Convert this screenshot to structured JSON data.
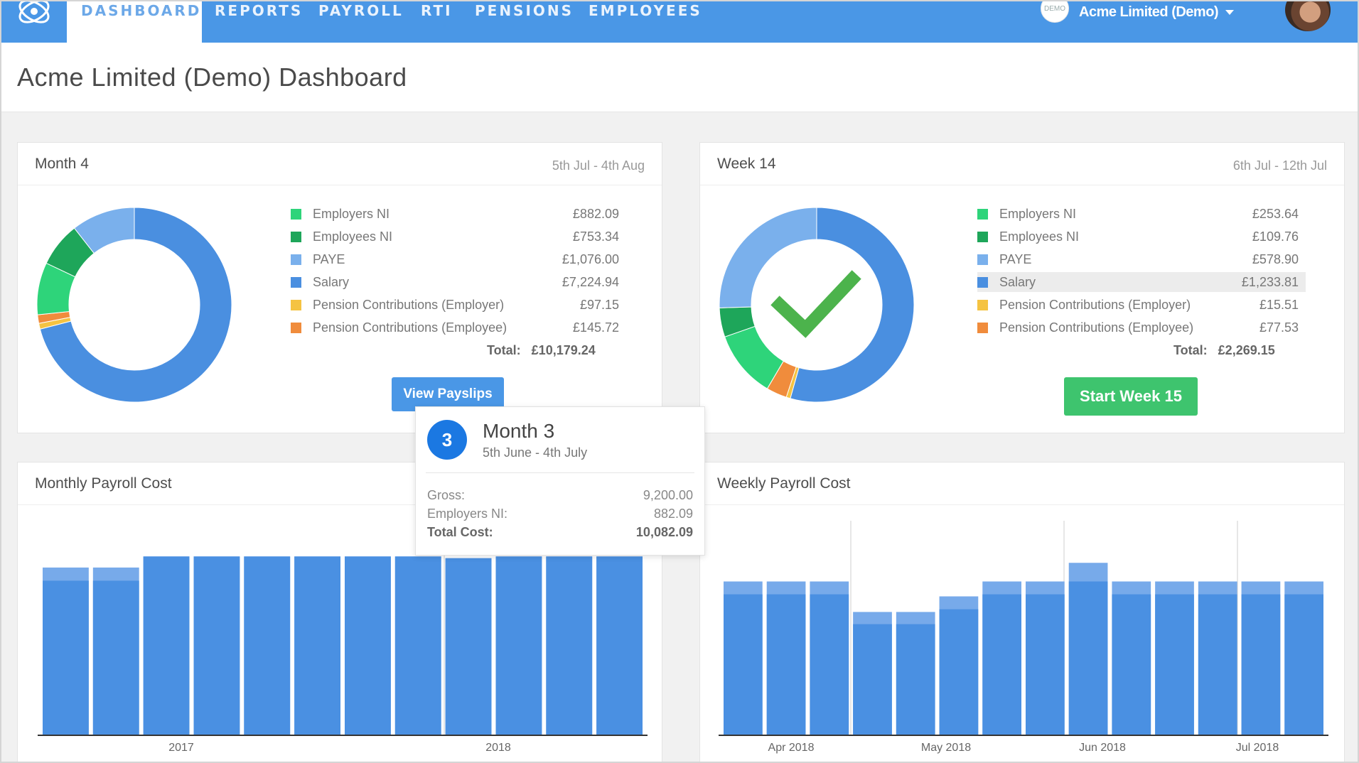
{
  "nav": {
    "items": [
      "DASHBOARD",
      "REPORTS",
      "PAYROLL",
      "RTI",
      "PENSIONS",
      "EMPLOYEES"
    ],
    "active": "DASHBOARD",
    "company_badge": "DEMO",
    "company_name": "Acme Limited (Demo)"
  },
  "page": {
    "title": "Acme Limited (Demo) Dashboard"
  },
  "colors": {
    "employers_ni": "#2ed47a",
    "employees_ni": "#1ea65a",
    "paye": "#7ab0ec",
    "salary": "#4a8fe0",
    "pension_employer": "#f5c342",
    "pension_employee": "#f08c3c",
    "nav_blue": "#4a97e6",
    "bar_blue": "#4a90e2",
    "bar_top": "#77aaea",
    "check_green": "#4cb34c"
  },
  "month_card": {
    "title": "Month 4",
    "date_range": "5th Jul - 4th Aug",
    "legend": [
      {
        "label": "Employers NI",
        "value": "£882.09",
        "amount": 882.09,
        "color_key": "employers_ni"
      },
      {
        "label": "Employees NI",
        "value": "£753.34",
        "amount": 753.34,
        "color_key": "employees_ni"
      },
      {
        "label": "PAYE",
        "value": "£1,076.00",
        "amount": 1076.0,
        "color_key": "paye"
      },
      {
        "label": "Salary",
        "value": "£7,224.94",
        "amount": 7224.94,
        "color_key": "salary"
      },
      {
        "label": "Pension Contributions (Employer)",
        "value": "£97.15",
        "amount": 97.15,
        "color_key": "pension_employer"
      },
      {
        "label": "Pension Contributions (Employee)",
        "value": "£145.72",
        "amount": 145.72,
        "color_key": "pension_employee"
      }
    ],
    "total_label": "Total:",
    "total_value": "£10,179.24",
    "button_label": "View Payslips"
  },
  "week_card": {
    "title": "Week 14",
    "date_range": "6th Jul - 12th Jul",
    "legend": [
      {
        "label": "Employers NI",
        "value": "£253.64",
        "amount": 253.64,
        "color_key": "employers_ni"
      },
      {
        "label": "Employees NI",
        "value": "£109.76",
        "amount": 109.76,
        "color_key": "employees_ni"
      },
      {
        "label": "PAYE",
        "value": "£578.90",
        "amount": 578.9,
        "color_key": "paye"
      },
      {
        "label": "Salary",
        "value": "£1,233.81",
        "amount": 1233.81,
        "color_key": "salary",
        "highlighted": true
      },
      {
        "label": "Pension Contributions (Employer)",
        "value": "£15.51",
        "amount": 15.51,
        "color_key": "pension_employer"
      },
      {
        "label": "Pension Contributions (Employee)",
        "value": "£77.53",
        "amount": 77.53,
        "color_key": "pension_employee"
      }
    ],
    "total_label": "Total:",
    "total_value": "£2,269.15",
    "button_label": "Start Week 15",
    "complete": true
  },
  "monthly_chart": {
    "title": "Monthly Payroll Cost",
    "x_labels": [
      "2017",
      "2018"
    ]
  },
  "weekly_chart": {
    "title": "Weekly Payroll Cost",
    "x_labels": [
      "Apr 2018",
      "May 2018",
      "Jun 2018",
      "Jul 2018"
    ]
  },
  "chart_data": [
    {
      "type": "bar",
      "title": "Monthly Payroll Cost",
      "ylim": [
        0,
        11000
      ],
      "series": [
        {
          "name": "",
          "values": [
            8800,
            8800,
            10180,
            10180,
            10180,
            10180,
            10180,
            10180,
            10082,
            10180,
            10180,
            10180
          ]
        },
        {
          "name": "",
          "values": [
            9550,
            9550,
            10180,
            10180,
            10180,
            10180,
            10180,
            10180,
            10082,
            10180,
            10180,
            10180
          ]
        }
      ],
      "categories": [
        "1",
        "2",
        "3",
        "4",
        "5",
        "6",
        "7",
        "8",
        "9",
        "10",
        "11",
        "12"
      ],
      "x_tick_labels": [
        "2017",
        "2018"
      ]
    },
    {
      "type": "bar",
      "title": "Weekly Payroll Cost",
      "ylim": [
        0,
        2600
      ],
      "series": [
        {
          "name": "",
          "values": [
            2080,
            2080,
            2080,
            1640,
            1640,
            1860,
            2080,
            2080,
            2270,
            2080,
            2080,
            2080,
            2080,
            2080
          ]
        },
        {
          "name": "",
          "values": [
            2270,
            2270,
            2270,
            1820,
            1820,
            2050,
            2270,
            2270,
            2545,
            2270,
            2270,
            2270,
            2270,
            2270
          ]
        }
      ],
      "categories": [
        "1",
        "2",
        "3",
        "4",
        "5",
        "6",
        "7",
        "8",
        "9",
        "10",
        "11",
        "12",
        "13",
        "14"
      ],
      "x_tick_labels": [
        "Apr 2018",
        "May 2018",
        "Jun 2018",
        "Jul 2018"
      ]
    }
  ],
  "tooltip": {
    "number": "3",
    "title": "Month 3",
    "date_range": "5th June - 4th July",
    "rows": [
      {
        "label": "Gross:",
        "value": "9,200.00"
      },
      {
        "label": "Employers NI:",
        "value": "882.09"
      },
      {
        "label": "Total Cost:",
        "value": "10,082.09"
      }
    ]
  }
}
